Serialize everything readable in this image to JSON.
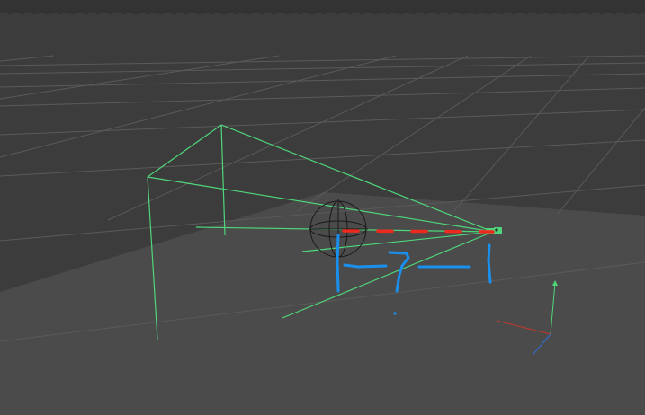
{
  "viewport": {
    "view_mode": "perspective",
    "grid_visible": true,
    "colors": {
      "background": "#3c3c3c",
      "floor_plane": "#4b4b4b",
      "grid_line": "#5a5a5a",
      "selection_wire": "#4fd67a",
      "axis_x": "#c0392b",
      "axis_y": "#4fd67a",
      "axis_z": "#2e6fd8",
      "annotation_red": "#ee2a1f",
      "annotation_blue": "#1a90ee",
      "null_gizmo": "#1a1a1a"
    }
  },
  "scene_objects": {
    "camera": {
      "icon": "camera-icon"
    },
    "target_null": {
      "icon": "crosshair-sphere-icon"
    }
  }
}
